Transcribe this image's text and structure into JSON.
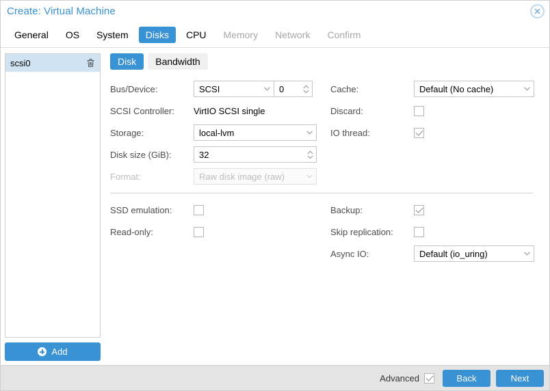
{
  "window": {
    "title": "Create: Virtual Machine",
    "close_icon": "close-circle-icon"
  },
  "tabs": [
    {
      "label": "General",
      "state": "enabled"
    },
    {
      "label": "OS",
      "state": "enabled"
    },
    {
      "label": "System",
      "state": "enabled"
    },
    {
      "label": "Disks",
      "state": "active"
    },
    {
      "label": "CPU",
      "state": "enabled"
    },
    {
      "label": "Memory",
      "state": "disabled"
    },
    {
      "label": "Network",
      "state": "disabled"
    },
    {
      "label": "Confirm",
      "state": "disabled"
    }
  ],
  "sidebar": {
    "items": [
      {
        "label": "scsi0",
        "selected": true,
        "delete_icon": "trash-icon"
      }
    ],
    "add_label": "Add",
    "add_icon": "plus-circle-icon"
  },
  "sub_tabs": [
    {
      "label": "Disk",
      "state": "active"
    },
    {
      "label": "Bandwidth",
      "state": "enabled"
    }
  ],
  "form": {
    "bus_device": {
      "label": "Bus/Device:",
      "bus_value": "SCSI",
      "device_value": "0"
    },
    "scsi_controller": {
      "label": "SCSI Controller:",
      "value": "VirtIO SCSI single"
    },
    "storage": {
      "label": "Storage:",
      "value": "local-lvm"
    },
    "disk_size": {
      "label": "Disk size (GiB):",
      "value": "32"
    },
    "format": {
      "label": "Format:",
      "value": "Raw disk image (raw)",
      "disabled": true
    },
    "cache": {
      "label": "Cache:",
      "value": "Default (No cache)"
    },
    "discard": {
      "label": "Discard:",
      "checked": false
    },
    "io_thread": {
      "label": "IO thread:",
      "checked": true
    },
    "ssd_emulation": {
      "label": "SSD emulation:",
      "checked": false
    },
    "read_only": {
      "label": "Read-only:",
      "checked": false
    },
    "backup": {
      "label": "Backup:",
      "checked": true
    },
    "skip_replication": {
      "label": "Skip replication:",
      "checked": false
    },
    "async_io": {
      "label": "Async IO:",
      "value": "Default (io_uring)"
    }
  },
  "footer": {
    "advanced_label": "Advanced",
    "advanced_checked": true,
    "back_label": "Back",
    "next_label": "Next"
  },
  "colors": {
    "accent": "#3892d4",
    "selection": "#cfe3f3",
    "footer_bg": "#e4e4e4",
    "label_text": "#4d4d4d",
    "disabled_text": "#bdbdbd"
  }
}
